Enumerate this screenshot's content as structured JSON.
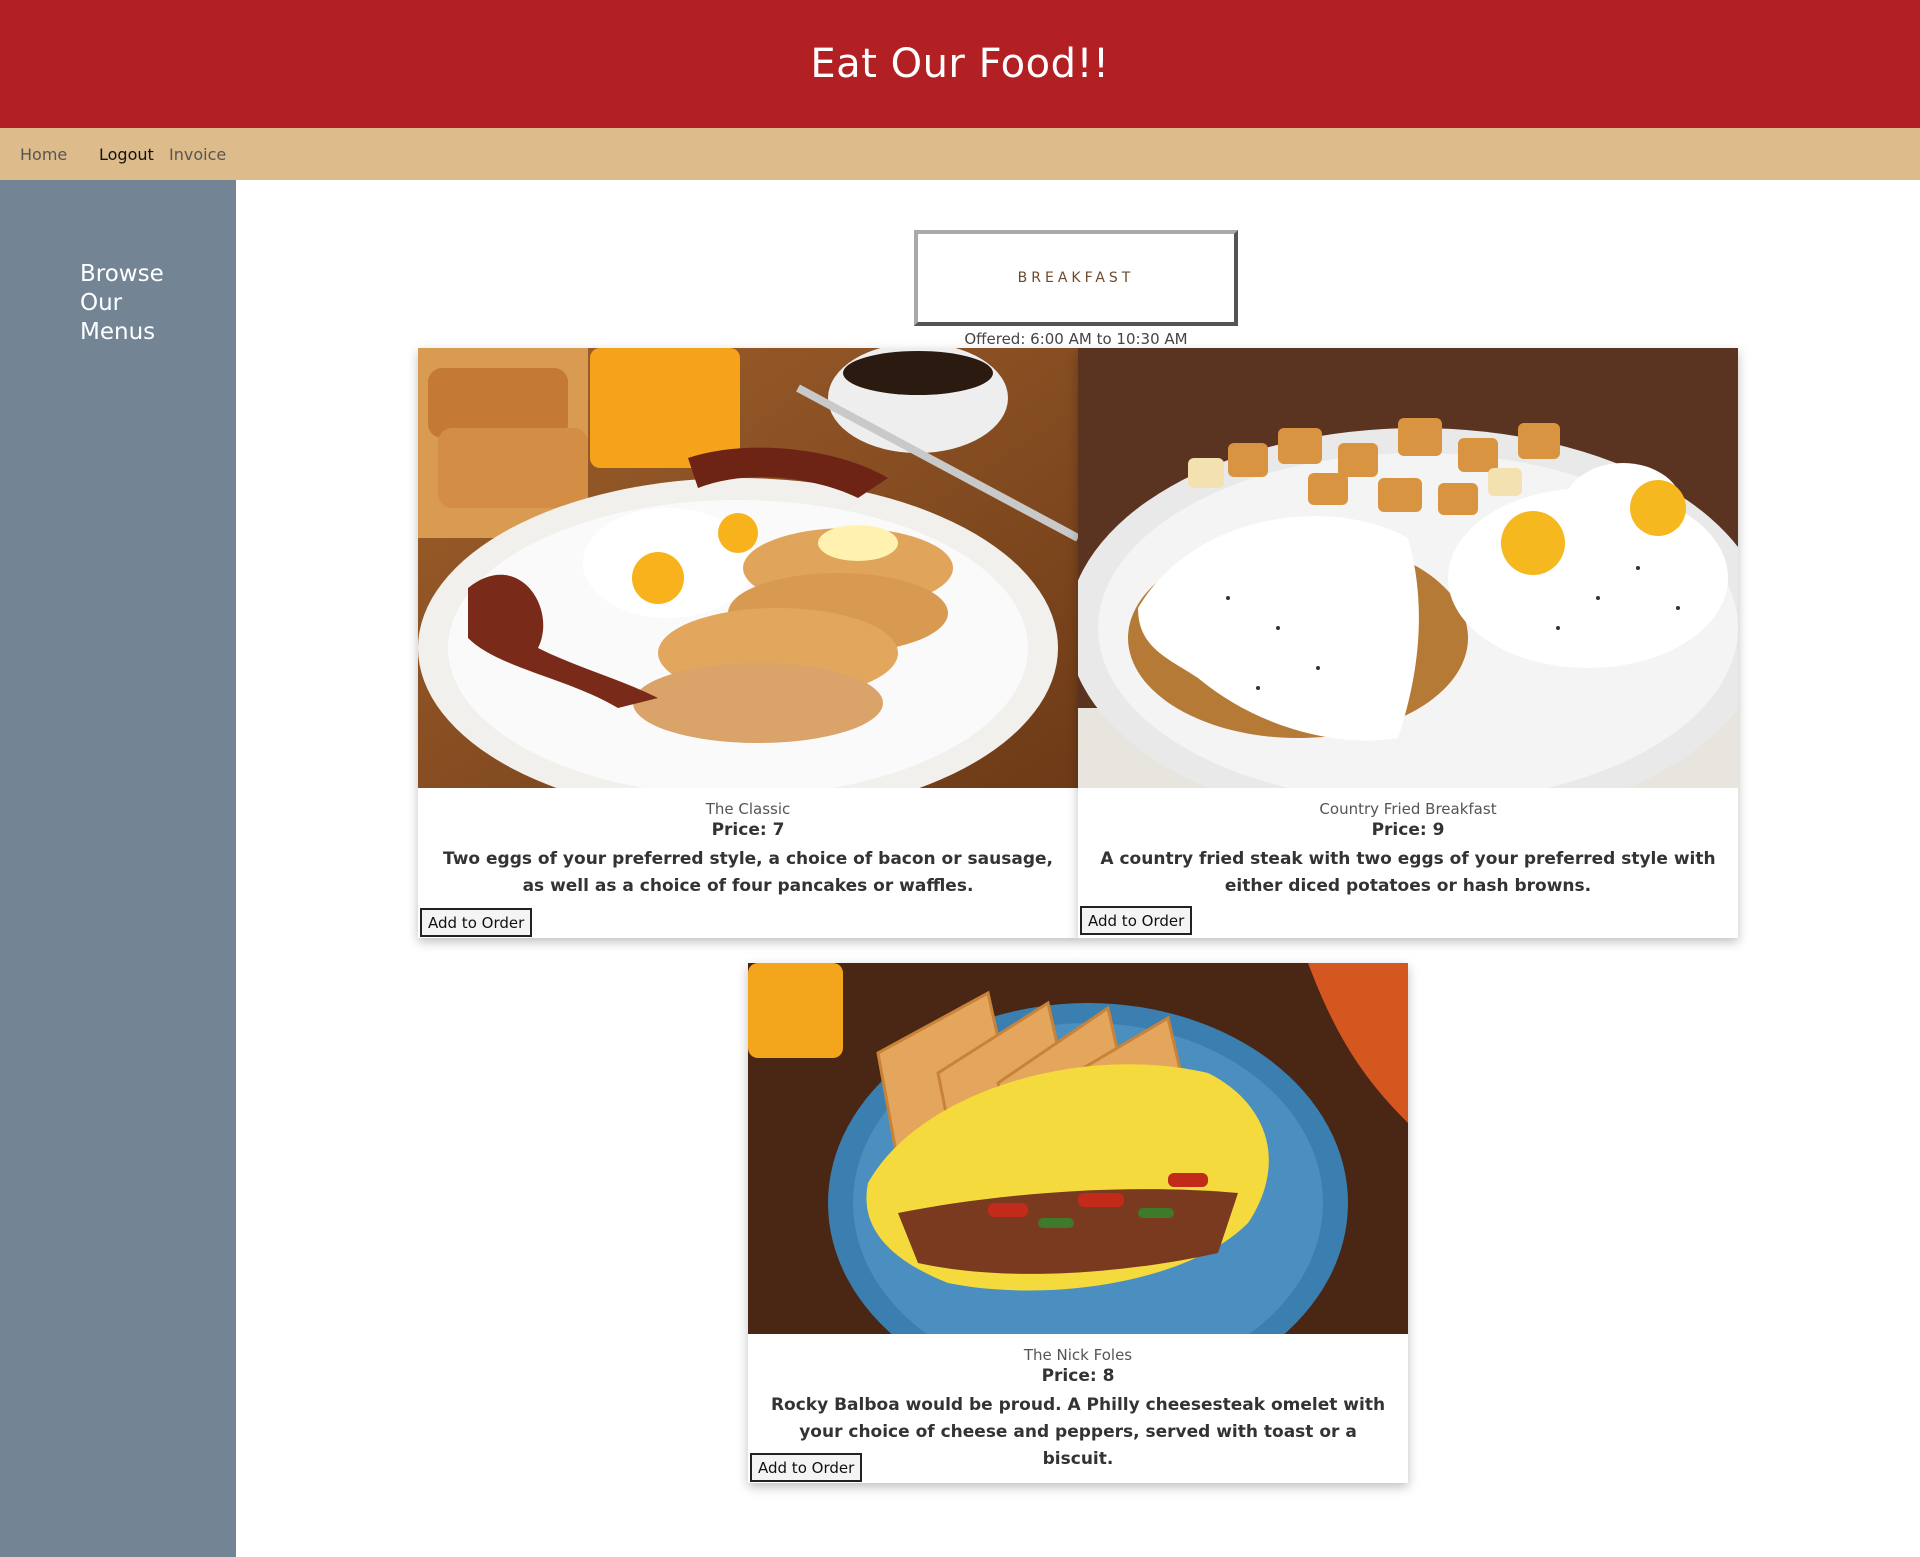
{
  "header": {
    "title": "Eat Our Food!!"
  },
  "nav": {
    "home": "Home",
    "logout": "Logout",
    "invoice": "Invoice"
  },
  "sidebar": {
    "title": "Browse Our Menus"
  },
  "menu": {
    "name": "BREAKFAST",
    "offered": "Offered: 6:00 AM to 10:30 AM"
  },
  "items": [
    {
      "name": "The Classic",
      "price": "Price: 7",
      "description": "Two eggs of your preferred style, a choice of bacon or sausage, as well as a choice of four pancakes or waffles.",
      "button": "Add to Order"
    },
    {
      "name": "Country Fried Breakfast",
      "price": "Price: 9",
      "description": "A country fried steak with two eggs of your preferred style with either diced potatoes or hash browns.",
      "button": "Add to Order"
    },
    {
      "name": "The Nick Foles",
      "price": "Price: 8",
      "description": "Rocky Balboa would be proud. A Philly cheesesteak omelet with your choice of cheese and peppers, served with toast or a biscuit.",
      "button": "Add to Order"
    }
  ],
  "colors": {
    "header": "#b22024",
    "navbar": "#debb8a",
    "sidebar": "#738595"
  }
}
